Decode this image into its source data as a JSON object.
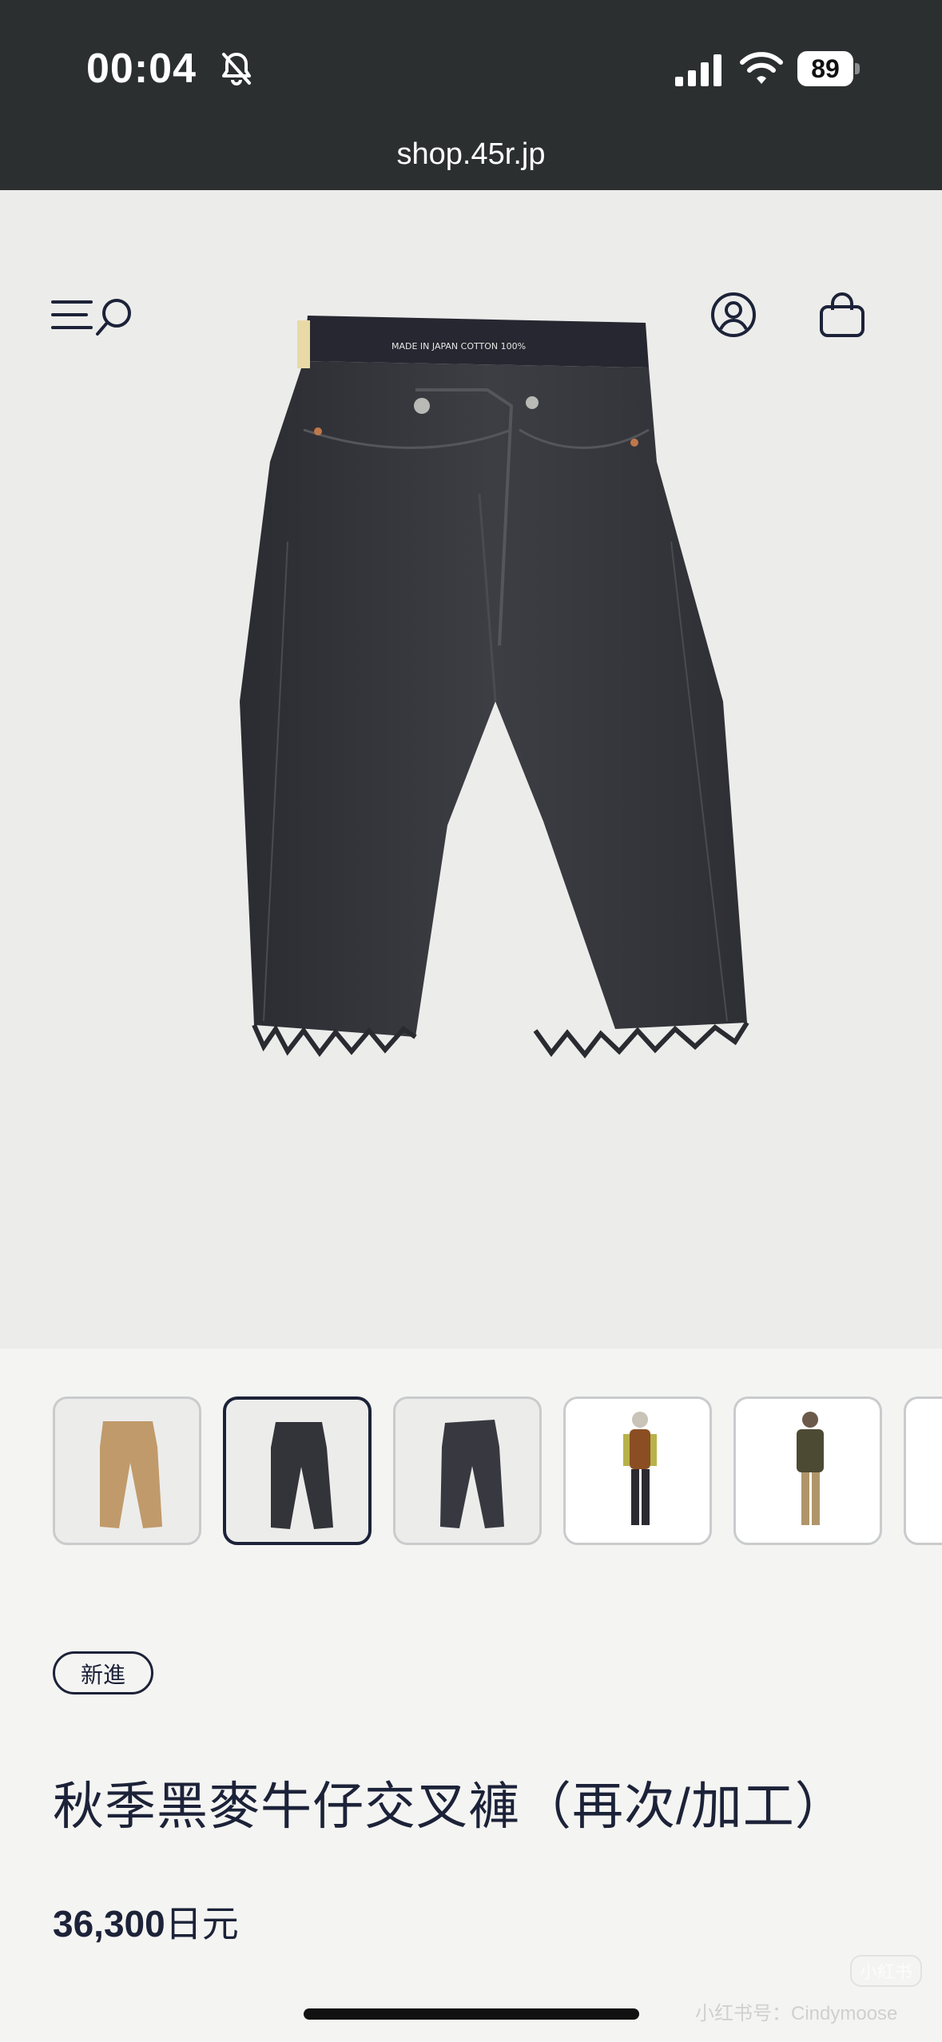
{
  "status_bar": {
    "time": "00:04",
    "battery_level": "89",
    "icons": [
      "bell-muted-icon",
      "cellular-signal-icon",
      "wifi-icon",
      "battery-icon"
    ]
  },
  "browser": {
    "url": "shop.45r.jp"
  },
  "header_icons": [
    "menu-icon",
    "search-icon",
    "account-icon",
    "cart-icon"
  ],
  "product": {
    "badge": "新進",
    "title": "秋季黑麥牛仔交叉褲（再次/加工）",
    "price_number": "36,300",
    "price_unit": "日元",
    "jeans_label": "MADE IN JAPAN   COTTON 100%"
  },
  "gallery": {
    "active_index": 1,
    "thumbnails": [
      "beige-pants",
      "black-jeans-front",
      "black-jeans-back",
      "model-orange-vest",
      "model-olive-jacket",
      "partial"
    ]
  },
  "watermark": {
    "badge": "小紅书",
    "text": "小红书号：Cindymoose"
  },
  "colors": {
    "accent": "#1c2238",
    "status_bar": "#2c2f30",
    "page_background": "#f4f4f2",
    "hero_background": "#ececeb"
  }
}
